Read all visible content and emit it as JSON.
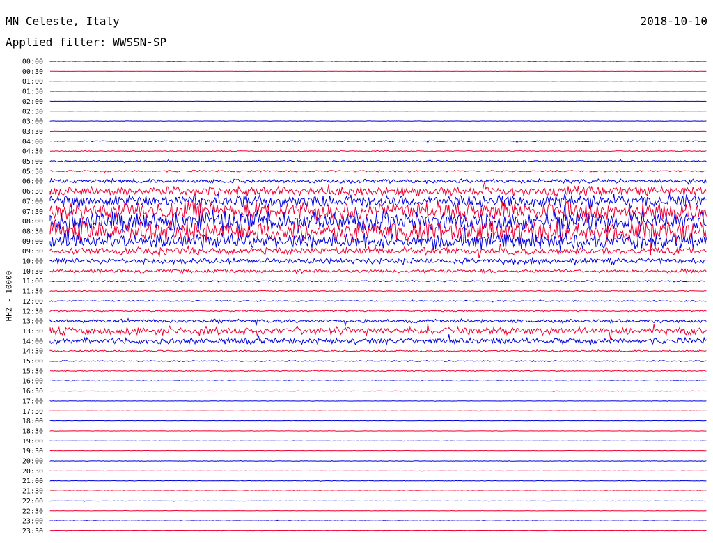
{
  "header": {
    "station": "MN Celeste, Italy",
    "date": "2018-10-10",
    "filter": "Applied filter: WWSSN-SP"
  },
  "colors": {
    "line_a": "#0000dd",
    "line_b": "#ee0033"
  },
  "chart_data": {
    "type": "line",
    "title": "MN Celeste, Italy",
    "ylabel": "HHZ - 10000",
    "row_labels": [
      "00:00",
      "00:30",
      "01:00",
      "01:30",
      "02:00",
      "02:30",
      "03:00",
      "03:30",
      "04:00",
      "04:30",
      "05:00",
      "05:30",
      "06:00",
      "06:30",
      "07:00",
      "07:30",
      "08:00",
      "08:30",
      "09:00",
      "09:30",
      "10:00",
      "10:30",
      "11:00",
      "11:30",
      "12:00",
      "12:30",
      "13:00",
      "13:30",
      "14:00",
      "14:30",
      "15:00",
      "15:30",
      "16:00",
      "16:30",
      "17:00",
      "17:30",
      "18:00",
      "18:30",
      "19:00",
      "19:30",
      "20:00",
      "20:30",
      "21:00",
      "21:30",
      "22:00",
      "22:30",
      "23:00",
      "23:30"
    ],
    "activity": [
      0.4,
      0.15,
      0.2,
      0.12,
      0.12,
      0.2,
      0.3,
      0.2,
      0.9,
      0.8,
      1.2,
      1.5,
      3.5,
      8,
      11,
      16,
      17,
      18,
      13,
      6,
      5,
      3,
      1.2,
      0.9,
      1,
      1.2,
      3,
      6.5,
      5,
      1.5,
      1,
      0.8,
      0.6,
      0.4,
      0.3,
      0.3,
      0.3,
      0.3,
      0.3,
      0.3,
      0.4,
      0.3,
      0.4,
      0.4,
      0.3,
      0.3,
      0.4,
      0.3
    ]
  }
}
